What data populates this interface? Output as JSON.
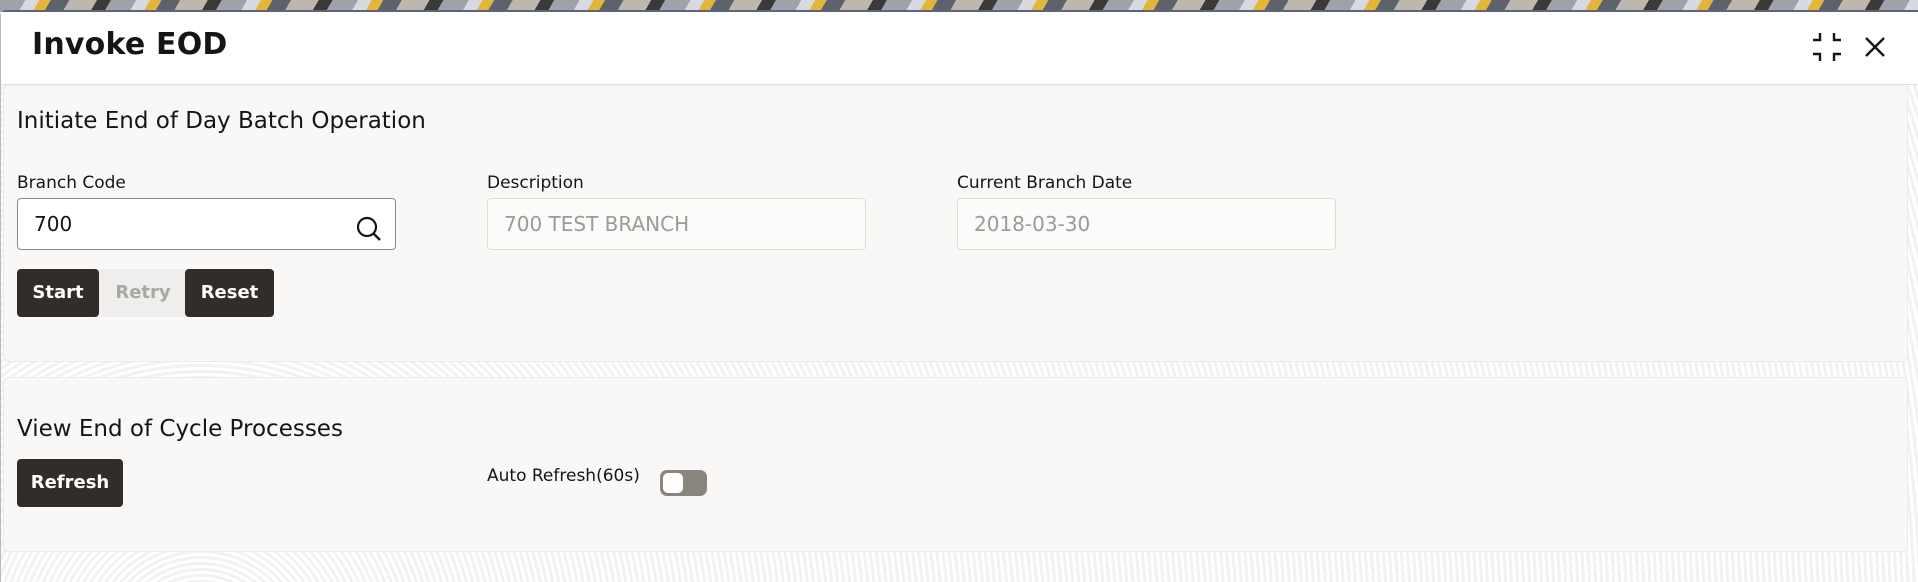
{
  "window": {
    "title": "Invoke EOD",
    "icons": [
      "collapse-icon",
      "close-icon"
    ]
  },
  "initiate_section": {
    "title": "Initiate End of Day Batch Operation",
    "fields": {
      "branch_code": {
        "label": "Branch Code",
        "value": "700",
        "icon": "search-icon"
      },
      "description": {
        "label": "Description",
        "value": "700 TEST BRANCH"
      },
      "current_branch_date": {
        "label": "Current Branch Date",
        "value": "2018-03-30"
      }
    },
    "buttons": {
      "start": "Start",
      "retry": "Retry",
      "reset": "Reset"
    }
  },
  "view_section": {
    "title": "View End of Cycle Processes",
    "refresh_label": "Refresh",
    "auto_refresh": {
      "label": "Auto Refresh(60s)",
      "enabled": false
    }
  },
  "colors": {
    "primary_button": "#312d2a",
    "disabled_button": "#efeeec",
    "toggle_off": "#8b857f"
  }
}
